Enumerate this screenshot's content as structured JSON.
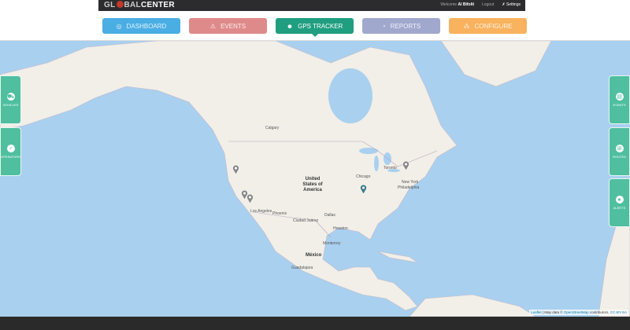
{
  "header": {
    "logo_left": "GL",
    "logo_mid": "BAL",
    "logo_bold": "CENTER",
    "welcome": "Welcome",
    "user": "Al Bifolti",
    "logout": "Logout",
    "settings": "Settings"
  },
  "nav": [
    {
      "label": "DASHBOARD",
      "icon": "dashboard-icon",
      "color": "#4aaee4"
    },
    {
      "label": "EVENTS",
      "icon": "warning-icon",
      "color": "#df8a8a"
    },
    {
      "label": "GPS TRACKER",
      "icon": "user-pin-icon",
      "color": "#1f9e80",
      "active": true
    },
    {
      "label": "REPORTS",
      "icon": "pie-chart-icon",
      "color": "#a1a8ce"
    },
    {
      "label": "CONFIGURE",
      "icon": "sitemap-icon",
      "color": "#f9b25d"
    }
  ],
  "left_panels": [
    {
      "label": "VEHICLES",
      "icon": "car-icon"
    },
    {
      "label": "OPERATORS",
      "icon": "operator-icon"
    }
  ],
  "right_panels": [
    {
      "label": "EVENTS",
      "icon": "events-icon"
    },
    {
      "label": "ROUTES",
      "icon": "routes-icon"
    },
    {
      "label": "ALERTS",
      "icon": "alert-icon"
    }
  ],
  "map": {
    "labels": {
      "country": "United States of America",
      "calgary": "Calgary",
      "chicago": "Chicago",
      "toronto": "Toronto",
      "newyork": "New York",
      "philadelphia": "Philadelphia",
      "dallas": "Dallas",
      "houston": "Houston",
      "losangeles": "Los Angeles",
      "phoenix": "Phoenix",
      "juarez": "Ciudad Juárez",
      "monterrey": "Monterrey",
      "mexico": "México",
      "guadalajara": "Guadalajara"
    },
    "attribution": {
      "leaflet": "Leaflet",
      "text": " | Map data © ",
      "osm": "OpenStreetMap",
      "contrib": " contributors, ",
      "license": "CC-BY-SA"
    }
  }
}
